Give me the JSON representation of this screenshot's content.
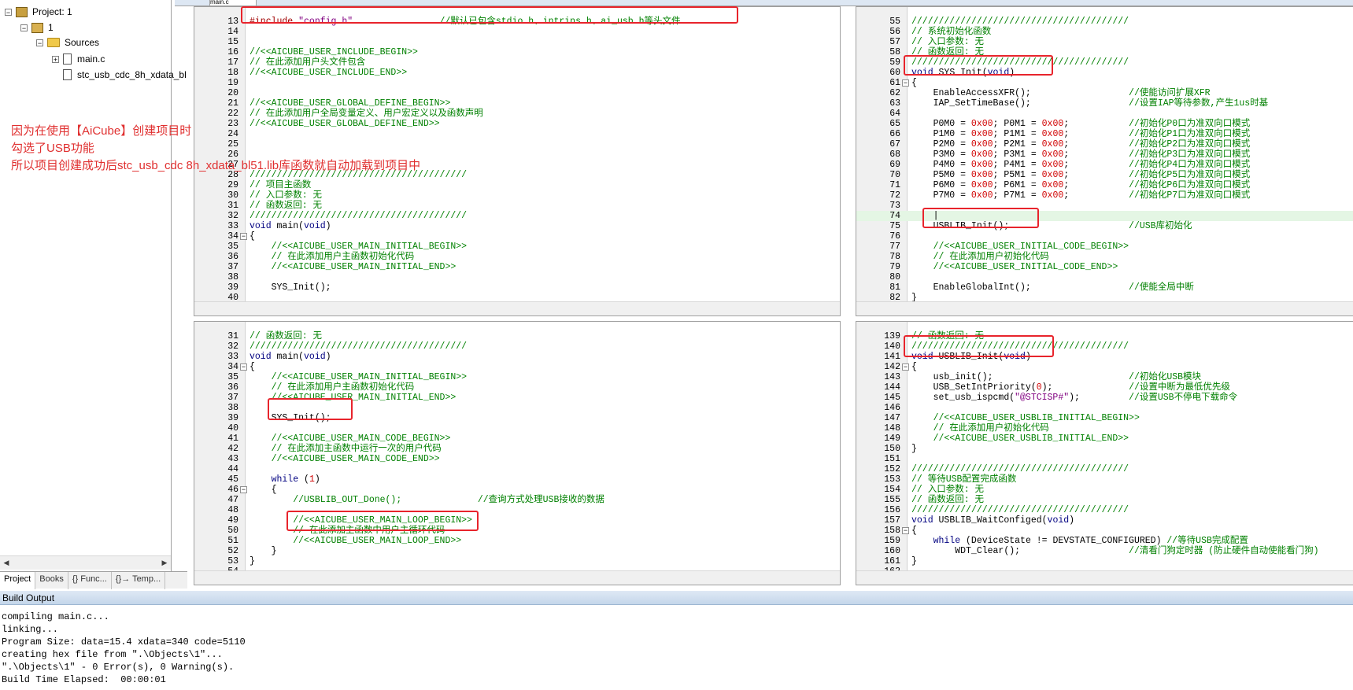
{
  "project_tree": {
    "root_label": "Project: 1",
    "target_label": "1",
    "group_label": "Sources",
    "files": [
      "main.c",
      "stc_usb_cdc_8h_xdata_bl"
    ]
  },
  "panel_tabs": [
    "Project",
    "Books",
    "{} Func...",
    "{}→ Temp..."
  ],
  "editor_tab": "main.c",
  "annotation": {
    "line1": "因为在使用【AiCube】创建项目时",
    "line2": "勾选了USB功能",
    "line3": "所以项目创建成功后stc_usb_cdc 8h_xdata_bl51.lib库函数就自动加载到项目中"
  },
  "panes": {
    "top_left": [
      {
        "n": "13",
        "segs": [
          [
            "pp",
            "#include "
          ],
          [
            "st",
            "\"config.h\""
          ],
          [
            "cm",
            "                //默认已包含stdio.h、intrins.h、ai_usb.h等头文件"
          ]
        ]
      },
      {
        "n": "14",
        "segs": []
      },
      {
        "n": "15",
        "segs": []
      },
      {
        "n": "16",
        "segs": [
          [
            "cm",
            "//<<AICUBE_USER_INCLUDE_BEGIN>>"
          ]
        ]
      },
      {
        "n": "17",
        "segs": [
          [
            "cm",
            "// 在此添加用户头文件包含"
          ]
        ]
      },
      {
        "n": "18",
        "segs": [
          [
            "cm",
            "//<<AICUBE_USER_INCLUDE_END>>"
          ]
        ]
      },
      {
        "n": "19",
        "segs": []
      },
      {
        "n": "20",
        "segs": []
      },
      {
        "n": "21",
        "segs": [
          [
            "cm",
            "//<<AICUBE_USER_GLOBAL_DEFINE_BEGIN>>"
          ]
        ]
      },
      {
        "n": "22",
        "segs": [
          [
            "cm",
            "// 在此添加用户全局变量定义、用户宏定义以及函数声明"
          ]
        ]
      },
      {
        "n": "23",
        "segs": [
          [
            "cm",
            "//<<AICUBE_USER_GLOBAL_DEFINE_END>>"
          ]
        ]
      },
      {
        "n": "24",
        "segs": []
      },
      {
        "n": "25",
        "segs": []
      },
      {
        "n": "26",
        "segs": []
      },
      {
        "n": "27",
        "segs": []
      },
      {
        "n": "28",
        "segs": [
          [
            "cm",
            "////////////////////////////////////////"
          ]
        ]
      },
      {
        "n": "29",
        "segs": [
          [
            "cm",
            "// 项目主函数"
          ]
        ]
      },
      {
        "n": "30",
        "segs": [
          [
            "cm",
            "// 入口参数: 无"
          ]
        ]
      },
      {
        "n": "31",
        "segs": [
          [
            "cm",
            "// 函数返回: 无"
          ]
        ]
      },
      {
        "n": "32",
        "segs": [
          [
            "cm",
            "////////////////////////////////////////"
          ]
        ]
      },
      {
        "n": "33",
        "segs": [
          [
            "kw",
            "void"
          ],
          [
            "tx",
            " main("
          ],
          [
            "kw",
            "void"
          ],
          [
            "tx",
            ")"
          ]
        ]
      },
      {
        "n": "34",
        "fold": "-",
        "segs": [
          [
            "tx",
            "{"
          ]
        ]
      },
      {
        "n": "35",
        "segs": [
          [
            "cm",
            "    //<<AICUBE_USER_MAIN_INITIAL_BEGIN>>"
          ]
        ]
      },
      {
        "n": "36",
        "segs": [
          [
            "cm",
            "    // 在此添加用户主函数初始化代码"
          ]
        ]
      },
      {
        "n": "37",
        "segs": [
          [
            "cm",
            "    //<<AICUBE_USER_MAIN_INITIAL_END>>"
          ]
        ]
      },
      {
        "n": "38",
        "segs": []
      },
      {
        "n": "39",
        "segs": [
          [
            "tx",
            "    SYS_Init();"
          ]
        ]
      },
      {
        "n": "40",
        "segs": []
      },
      {
        "n": "41",
        "segs": [
          [
            "cm",
            "    //<<AICUBE_USER_MAIN_CODE_BEGIN>>"
          ]
        ]
      }
    ],
    "top_right": [
      {
        "n": "55",
        "segs": [
          [
            "cm",
            "////////////////////////////////////////"
          ]
        ]
      },
      {
        "n": "56",
        "segs": [
          [
            "cm",
            "// 系统初始化函数"
          ]
        ]
      },
      {
        "n": "57",
        "segs": [
          [
            "cm",
            "// 入口参数: 无"
          ]
        ]
      },
      {
        "n": "58",
        "segs": [
          [
            "cm",
            "// 函数返回: 无"
          ]
        ]
      },
      {
        "n": "59",
        "segs": [
          [
            "cm",
            "////////////////////////////////////////"
          ]
        ]
      },
      {
        "n": "60",
        "segs": [
          [
            "kw",
            "void"
          ],
          [
            "tx",
            " SYS_Init("
          ],
          [
            "kw",
            "void"
          ],
          [
            "tx",
            ")"
          ]
        ]
      },
      {
        "n": "61",
        "fold": "-",
        "segs": [
          [
            "tx",
            "{"
          ]
        ]
      },
      {
        "n": "62",
        "segs": [
          [
            "tx",
            "    EnableAccessXFR();                  "
          ],
          [
            "cm",
            "//使能访问扩展XFR"
          ]
        ]
      },
      {
        "n": "63",
        "segs": [
          [
            "tx",
            "    IAP_SetTimeBase();                  "
          ],
          [
            "cm",
            "//设置IAP等待参数,产生1us时基"
          ]
        ]
      },
      {
        "n": "64",
        "segs": []
      },
      {
        "n": "65",
        "segs": [
          [
            "tx",
            "    P0M0 = "
          ],
          [
            "nb",
            "0x00"
          ],
          [
            "tx",
            "; P0M1 = "
          ],
          [
            "nb",
            "0x00"
          ],
          [
            "tx",
            ";           "
          ],
          [
            "cm",
            "//初始化P0口为准双向口模式"
          ]
        ]
      },
      {
        "n": "66",
        "segs": [
          [
            "tx",
            "    P1M0 = "
          ],
          [
            "nb",
            "0x00"
          ],
          [
            "tx",
            "; P1M1 = "
          ],
          [
            "nb",
            "0x00"
          ],
          [
            "tx",
            ";           "
          ],
          [
            "cm",
            "//初始化P1口为准双向口模式"
          ]
        ]
      },
      {
        "n": "67",
        "segs": [
          [
            "tx",
            "    P2M0 = "
          ],
          [
            "nb",
            "0x00"
          ],
          [
            "tx",
            "; P2M1 = "
          ],
          [
            "nb",
            "0x00"
          ],
          [
            "tx",
            ";           "
          ],
          [
            "cm",
            "//初始化P2口为准双向口模式"
          ]
        ]
      },
      {
        "n": "68",
        "segs": [
          [
            "tx",
            "    P3M0 = "
          ],
          [
            "nb",
            "0x00"
          ],
          [
            "tx",
            "; P3M1 = "
          ],
          [
            "nb",
            "0x00"
          ],
          [
            "tx",
            ";           "
          ],
          [
            "cm",
            "//初始化P3口为准双向口模式"
          ]
        ]
      },
      {
        "n": "69",
        "segs": [
          [
            "tx",
            "    P4M0 = "
          ],
          [
            "nb",
            "0x00"
          ],
          [
            "tx",
            "; P4M1 = "
          ],
          [
            "nb",
            "0x00"
          ],
          [
            "tx",
            ";           "
          ],
          [
            "cm",
            "//初始化P4口为准双向口模式"
          ]
        ]
      },
      {
        "n": "70",
        "segs": [
          [
            "tx",
            "    P5M0 = "
          ],
          [
            "nb",
            "0x00"
          ],
          [
            "tx",
            "; P5M1 = "
          ],
          [
            "nb",
            "0x00"
          ],
          [
            "tx",
            ";           "
          ],
          [
            "cm",
            "//初始化P5口为准双向口模式"
          ]
        ]
      },
      {
        "n": "71",
        "segs": [
          [
            "tx",
            "    P6M0 = "
          ],
          [
            "nb",
            "0x00"
          ],
          [
            "tx",
            "; P6M1 = "
          ],
          [
            "nb",
            "0x00"
          ],
          [
            "tx",
            ";           "
          ],
          [
            "cm",
            "//初始化P6口为准双向口模式"
          ]
        ]
      },
      {
        "n": "72",
        "segs": [
          [
            "tx",
            "    P7M0 = "
          ],
          [
            "nb",
            "0x00"
          ],
          [
            "tx",
            "; P7M1 = "
          ],
          [
            "nb",
            "0x00"
          ],
          [
            "tx",
            ";           "
          ],
          [
            "cm",
            "//初始化P7口为准双向口模式"
          ]
        ]
      },
      {
        "n": "73",
        "segs": []
      },
      {
        "n": "74",
        "hl": true,
        "segs": [
          [
            "tx",
            "    |"
          ]
        ]
      },
      {
        "n": "75",
        "segs": [
          [
            "tx",
            "    USBLIB_Init();                      "
          ],
          [
            "cm",
            "//USB库初始化"
          ]
        ]
      },
      {
        "n": "76",
        "segs": []
      },
      {
        "n": "77",
        "segs": [
          [
            "cm",
            "    //<<AICUBE_USER_INITIAL_CODE_BEGIN>>"
          ]
        ]
      },
      {
        "n": "78",
        "segs": [
          [
            "cm",
            "    // 在此添加用户初始化代码"
          ]
        ]
      },
      {
        "n": "79",
        "segs": [
          [
            "cm",
            "    //<<AICUBE_USER_INITIAL_CODE_END>>"
          ]
        ]
      },
      {
        "n": "80",
        "segs": []
      },
      {
        "n": "81",
        "segs": [
          [
            "tx",
            "    EnableGlobalInt();                  "
          ],
          [
            "cm",
            "//使能全局中断"
          ]
        ]
      },
      {
        "n": "82",
        "segs": [
          [
            "tx",
            "}"
          ]
        ]
      },
      {
        "n": "83",
        "segs": []
      }
    ],
    "bottom_left": [
      {
        "n": "31",
        "segs": [
          [
            "cm",
            "// 函数返回: 无"
          ]
        ]
      },
      {
        "n": "32",
        "segs": [
          [
            "cm",
            "////////////////////////////////////////"
          ]
        ]
      },
      {
        "n": "33",
        "segs": [
          [
            "kw",
            "void"
          ],
          [
            "tx",
            " main("
          ],
          [
            "kw",
            "void"
          ],
          [
            "tx",
            ")"
          ]
        ]
      },
      {
        "n": "34",
        "fold": "-",
        "segs": [
          [
            "tx",
            "{"
          ]
        ]
      },
      {
        "n": "35",
        "segs": [
          [
            "cm",
            "    //<<AICUBE_USER_MAIN_INITIAL_BEGIN>>"
          ]
        ]
      },
      {
        "n": "36",
        "segs": [
          [
            "cm",
            "    // 在此添加用户主函数初始化代码"
          ]
        ]
      },
      {
        "n": "37",
        "segs": [
          [
            "cm",
            "    //<<AICUBE_USER_MAIN_INITIAL_END>>"
          ]
        ]
      },
      {
        "n": "38",
        "segs": []
      },
      {
        "n": "39",
        "segs": [
          [
            "tx",
            "    SYS_Init();"
          ]
        ]
      },
      {
        "n": "40",
        "segs": []
      },
      {
        "n": "41",
        "segs": [
          [
            "cm",
            "    //<<AICUBE_USER_MAIN_CODE_BEGIN>>"
          ]
        ]
      },
      {
        "n": "42",
        "segs": [
          [
            "cm",
            "    // 在此添加主函数中运行一次的用户代码"
          ]
        ]
      },
      {
        "n": "43",
        "segs": [
          [
            "cm",
            "    //<<AICUBE_USER_MAIN_CODE_END>>"
          ]
        ]
      },
      {
        "n": "44",
        "segs": []
      },
      {
        "n": "45",
        "segs": [
          [
            "kw",
            "    while"
          ],
          [
            "tx",
            " ("
          ],
          [
            "nb",
            "1"
          ],
          [
            "tx",
            ")"
          ]
        ]
      },
      {
        "n": "46",
        "fold": "-",
        "segs": [
          [
            "tx",
            "    {"
          ]
        ]
      },
      {
        "n": "47",
        "segs": [
          [
            "cm",
            "        //USBLIB_OUT_Done();              //查询方式处理USB接收的数据"
          ]
        ]
      },
      {
        "n": "48",
        "segs": []
      },
      {
        "n": "49",
        "segs": [
          [
            "cm",
            "        //<<AICUBE_USER_MAIN_LOOP_BEGIN>>"
          ]
        ]
      },
      {
        "n": "50",
        "segs": [
          [
            "cm",
            "        // 在此添加主函数中用户主循环代码"
          ]
        ]
      },
      {
        "n": "51",
        "segs": [
          [
            "cm",
            "        //<<AICUBE_USER_MAIN_LOOP_END>>"
          ]
        ]
      },
      {
        "n": "52",
        "segs": [
          [
            "tx",
            "    }"
          ]
        ]
      },
      {
        "n": "53",
        "segs": [
          [
            "tx",
            "}"
          ]
        ]
      },
      {
        "n": "54",
        "segs": []
      }
    ],
    "bottom_right": [
      {
        "n": "139",
        "segs": [
          [
            "cm",
            "// 函数返回: 无"
          ]
        ]
      },
      {
        "n": "140",
        "segs": [
          [
            "cm",
            "////////////////////////////////////////"
          ]
        ]
      },
      {
        "n": "141",
        "segs": [
          [
            "kw",
            "void"
          ],
          [
            "tx",
            " USBLIB_Init("
          ],
          [
            "kw",
            "void"
          ],
          [
            "tx",
            ")"
          ]
        ]
      },
      {
        "n": "142",
        "fold": "-",
        "segs": [
          [
            "tx",
            "{"
          ]
        ]
      },
      {
        "n": "143",
        "segs": [
          [
            "tx",
            "    usb_init();                         "
          ],
          [
            "cm",
            "//初始化USB模块"
          ]
        ]
      },
      {
        "n": "144",
        "segs": [
          [
            "tx",
            "    USB_SetIntPriority("
          ],
          [
            "nb",
            "0"
          ],
          [
            "tx",
            ");              "
          ],
          [
            "cm",
            "//设置中断为最低优先级"
          ]
        ]
      },
      {
        "n": "145",
        "segs": [
          [
            "tx",
            "    set_usb_ispcmd("
          ],
          [
            "st",
            "\"@STCISP#\""
          ],
          [
            "tx",
            ");         "
          ],
          [
            "cm",
            "//设置USB不停电下载命令"
          ]
        ]
      },
      {
        "n": "146",
        "segs": []
      },
      {
        "n": "147",
        "segs": [
          [
            "cm",
            "    //<<AICUBE_USER_USBLIB_INITIAL_BEGIN>>"
          ]
        ]
      },
      {
        "n": "148",
        "segs": [
          [
            "cm",
            "    // 在此添加用户初始化代码"
          ]
        ]
      },
      {
        "n": "149",
        "segs": [
          [
            "cm",
            "    //<<AICUBE_USER_USBLIB_INITIAL_END>>"
          ]
        ]
      },
      {
        "n": "150",
        "segs": [
          [
            "tx",
            "}"
          ]
        ]
      },
      {
        "n": "151",
        "segs": []
      },
      {
        "n": "152",
        "segs": [
          [
            "cm",
            "////////////////////////////////////////"
          ]
        ]
      },
      {
        "n": "153",
        "segs": [
          [
            "cm",
            "// 等待USB配置完成函数"
          ]
        ]
      },
      {
        "n": "154",
        "segs": [
          [
            "cm",
            "// 入口参数: 无"
          ]
        ]
      },
      {
        "n": "155",
        "segs": [
          [
            "cm",
            "// 函数返回: 无"
          ]
        ]
      },
      {
        "n": "156",
        "segs": [
          [
            "cm",
            "////////////////////////////////////////"
          ]
        ]
      },
      {
        "n": "157",
        "segs": [
          [
            "kw",
            "void"
          ],
          [
            "tx",
            " USBLIB_WaitConfiged("
          ],
          [
            "kw",
            "void"
          ],
          [
            "tx",
            ")"
          ]
        ]
      },
      {
        "n": "158",
        "fold": "-",
        "segs": [
          [
            "tx",
            "{"
          ]
        ]
      },
      {
        "n": "159",
        "segs": [
          [
            "kw",
            "    while"
          ],
          [
            "tx",
            " (DeviceState != DEVSTATE_CONFIGURED) "
          ],
          [
            "cm",
            "//等待USB完成配置"
          ]
        ]
      },
      {
        "n": "160",
        "segs": [
          [
            "tx",
            "        WDT_Clear();                    "
          ],
          [
            "cm",
            "//清看门狗定时器 (防止硬件自动使能看门狗)"
          ]
        ]
      },
      {
        "n": "161",
        "segs": [
          [
            "tx",
            "}"
          ]
        ]
      },
      {
        "n": "162",
        "segs": []
      }
    ]
  },
  "build_output": {
    "title": "Build Output",
    "lines": [
      "compiling main.c...",
      "linking...",
      "Program Size: data=15.4 xdata=340 code=5110",
      "creating hex file from \".\\Objects\\1\"...",
      "\".\\Objects\\1\" - 0 Error(s), 0 Warning(s).",
      "Build Time Elapsed:  00:00:01"
    ]
  },
  "colors": {
    "annotation": "#e03030",
    "highlight_box": "#e8242c",
    "comment": "#008000",
    "keyword": "#000080"
  }
}
